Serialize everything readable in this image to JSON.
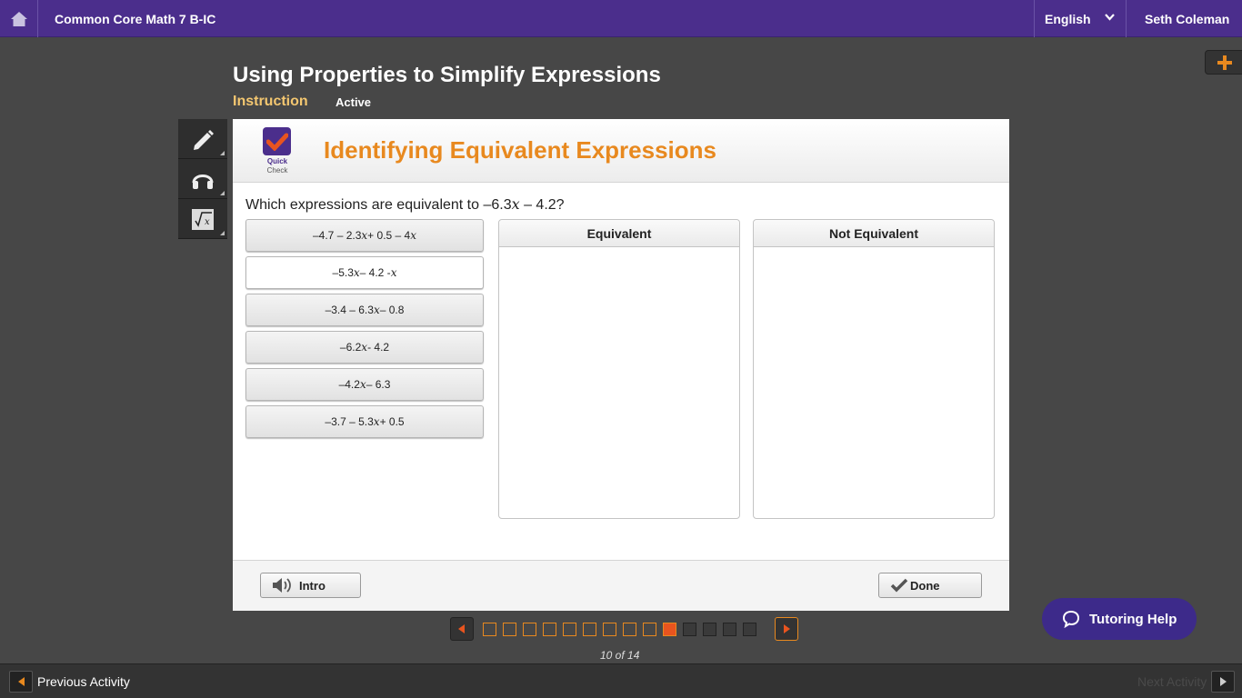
{
  "topbar": {
    "course_title": "Common Core Math 7 B-IC",
    "language": "English",
    "user_name": "Seth Coleman"
  },
  "lesson": {
    "title": "Using Properties to Simplify Expressions",
    "tab_instruction": "Instruction",
    "status": "Active"
  },
  "tools": [
    "pencil-icon",
    "headphones-icon",
    "formula-icon"
  ],
  "panel": {
    "logo_line1": "Quick",
    "logo_line2": "Check",
    "title": "Identifying Equivalent Expressions",
    "question_prefix": "Which expressions are equivalent to –6.3",
    "question_var": "x",
    "question_suffix": " – 4.2?",
    "options": [
      {
        "label": "–4.7 – 2.3x + 0.5 – 4x",
        "selected": false
      },
      {
        "label": "–5.3x – 4.2 - x",
        "selected": true
      },
      {
        "label": "–3.4 – 6.3x – 0.8",
        "selected": false
      },
      {
        "label": "–6.2x - 4.2",
        "selected": false
      },
      {
        "label": "–4.2x – 6.3",
        "selected": false
      },
      {
        "label": "–3.7 – 5.3x + 0.5",
        "selected": false
      }
    ],
    "bin_equivalent": "Equivalent",
    "bin_not_equivalent": "Not Equivalent",
    "intro_label": "Intro",
    "done_label": "Done"
  },
  "pager": {
    "total": 14,
    "current": 10,
    "count_text": "10 of 14"
  },
  "tutoring_label": "Tutoring Help",
  "bottom": {
    "previous": "Previous Activity",
    "next": "Next Activity"
  },
  "colors": {
    "brand_purple": "#4b2e8c",
    "accent_orange": "#e8891f",
    "background": "#474747"
  }
}
